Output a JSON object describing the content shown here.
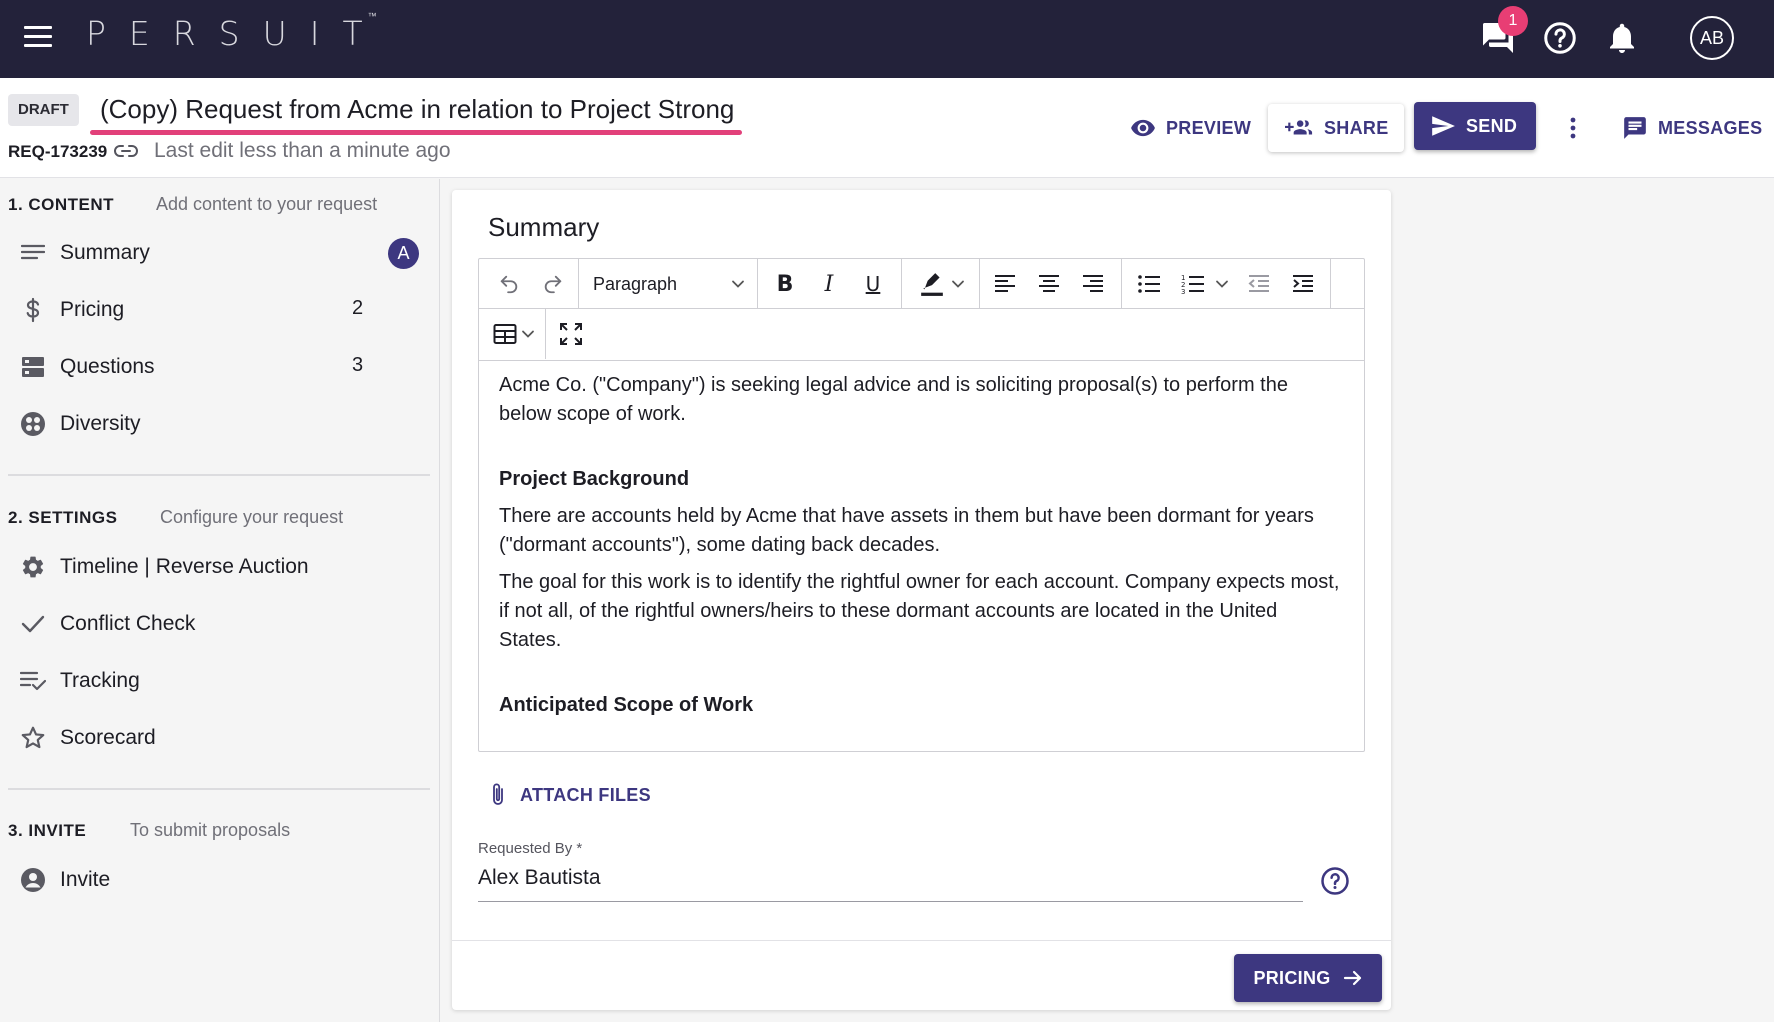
{
  "topbar": {
    "logo": "PERSUIT",
    "logo_mark": "™",
    "chat_badge": "1",
    "avatar_initials": "AB"
  },
  "header": {
    "status": "DRAFT",
    "title": "(Copy) Request from Acme in relation to Project Strong",
    "request_id": "REQ-173239",
    "last_edit": "Last edit less than a minute ago",
    "preview_label": "PREVIEW",
    "share_label": "SHARE",
    "send_label": "SEND",
    "messages_label": "MESSAGES"
  },
  "sidebar": {
    "content": {
      "heading": "1. CONTENT",
      "subtitle": "Add content to your request",
      "items": [
        {
          "label": "Summary",
          "icon": "summary-lines-icon",
          "avatar": "A"
        },
        {
          "label": "Pricing",
          "icon": "dollar-icon",
          "count": "2"
        },
        {
          "label": "Questions",
          "icon": "questions-icon",
          "count": "3"
        },
        {
          "label": "Diversity",
          "icon": "diversity-icon"
        }
      ]
    },
    "settings": {
      "heading": "2. SETTINGS",
      "subtitle": "Configure your request",
      "items": [
        {
          "label": "Timeline | Reverse Auction",
          "icon": "gear-icon"
        },
        {
          "label": "Conflict Check",
          "icon": "check-icon"
        },
        {
          "label": "Tracking",
          "icon": "tracking-icon"
        },
        {
          "label": "Scorecard",
          "icon": "star-icon"
        }
      ]
    },
    "invite": {
      "heading": "3. INVITE",
      "subtitle": "To submit proposals",
      "items": [
        {
          "label": "Invite",
          "icon": "person-icon"
        }
      ]
    }
  },
  "card": {
    "title": "Summary",
    "toolbar": {
      "block_format": "Paragraph",
      "bold": "B",
      "italic": "I",
      "underline": "U"
    },
    "body": {
      "intro": "Acme Co. (\"Company\") is seeking legal advice and is soliciting proposal(s) to perform the below scope of work.",
      "background_heading": "Project Background",
      "background_p1": "There are accounts held by Acme that have assets in them but have been dormant for years (\"dormant accounts\"), some dating back decades.",
      "background_p2": "The goal for this work is to identify the rightful owner for each account. Company expects most, if not all, of the rightful owners/heirs to these dormant accounts are located in the United States.",
      "scope_heading": "Anticipated Scope of Work"
    },
    "attach_label": "ATTACH FILES",
    "requested_by_label": "Requested By *",
    "requested_by_value": "Alex Bautista",
    "next_button": "PRICING"
  },
  "colors": {
    "topbar_bg": "#23223a",
    "primary": "#3d3780",
    "accent_pink": "#e2407a",
    "badge": "#e83e74"
  }
}
